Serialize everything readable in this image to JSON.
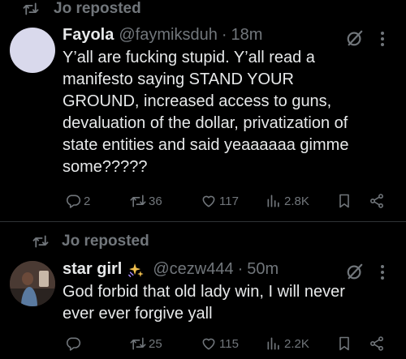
{
  "colors": {
    "background": "#000000",
    "text": "#e7e9ea",
    "muted": "#71767b",
    "divider": "#2f3336"
  },
  "posts": [
    {
      "repost_label": "Jo reposted",
      "author_name": "Fayola",
      "handle": "@faymiksduh",
      "separator": "·",
      "time": "18m",
      "text": "Y’all are fucking stupid. Y’all read a\nmanifesto saying STAND YOUR\nGROUND, increased access to guns,\ndevaluation of the dollar, privatization of\nstate entities and said yeaaaaaa gimme\nsome?????",
      "replies": "2",
      "reposts": "36",
      "likes": "117",
      "views": "2.8K",
      "icons": [
        "repost-icon",
        "grok-icon",
        "more-icon",
        "reply-icon",
        "repost-icon",
        "like-icon",
        "views-icon",
        "bookmark-icon",
        "share-icon"
      ]
    },
    {
      "repost_label": "Jo reposted",
      "author_name": "star girl",
      "handle": "@cezw444",
      "separator": "·",
      "time": "50m",
      "text": "God forbid that old lady win, I will never\never ever forgive yall",
      "replies": "",
      "reposts": "25",
      "likes": "115",
      "views": "2.2K",
      "icons": [
        "repost-icon",
        "sparkles-icon",
        "grok-icon",
        "more-icon",
        "reply-icon",
        "repost-icon",
        "like-icon",
        "views-icon",
        "bookmark-icon",
        "share-icon"
      ]
    }
  ]
}
